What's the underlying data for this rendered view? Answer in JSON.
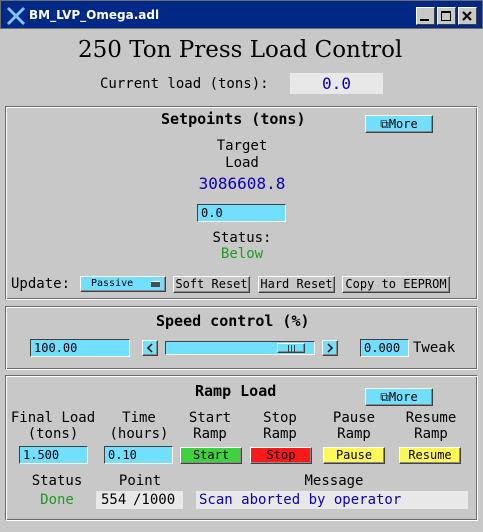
{
  "window": {
    "title": "BM_LVP_Omega.adl"
  },
  "header": {
    "title": "250 Ton Press Load Control",
    "current_load_label": "Current load (tons):",
    "current_load_value": "0.0"
  },
  "setpoints": {
    "heading": "Setpoints (tons)",
    "more_label": "More",
    "target_label_1": "Target",
    "target_label_2": "Load",
    "target_value": "3086608.8",
    "target_input": "0.0",
    "status_label": "Status:",
    "status_value": "Below",
    "update_label": "Update:",
    "update_mode": "Passive",
    "soft_reset": "Soft Reset",
    "hard_reset": "Hard Reset",
    "copy_eeprom": "Copy to EEPROM"
  },
  "speed": {
    "heading": "Speed control (%)",
    "value": "100.00",
    "tweak_value": "0.000",
    "tweak_label": "Tweak",
    "slider_fraction": 0.93
  },
  "ramp": {
    "heading": "Ramp Load",
    "more_label": "More",
    "final_load_label_1": "Final Load",
    "final_load_label_2": "(tons)",
    "time_label_1": "Time",
    "time_label_2": "(hours)",
    "start_label_1": "Start",
    "start_label_2": "Ramp",
    "stop_label_1": "Stop",
    "stop_label_2": "Ramp",
    "pause_label_1": "Pause",
    "pause_label_2": "Ramp",
    "resume_label_1": "Resume",
    "resume_label_2": "Ramp",
    "final_load_value": "1.500",
    "time_value": "0.10",
    "start_btn": "Start",
    "stop_btn": "Stop",
    "pause_btn": "Pause",
    "resume_btn": "Resume",
    "status_header": "Status",
    "point_header": "Point",
    "message_header": "Message",
    "status_value": "Done",
    "point_current": "554",
    "point_total": "/1000",
    "message_value": "Scan aborted by operator"
  },
  "colors": {
    "titlebar": "#002887",
    "entry": "#73dfff",
    "green_text": "#1e9a1e",
    "blue_text": "#0a00b8",
    "start": "#3fd13f",
    "stop": "#fb1a1a",
    "pause": "#fdf75a"
  }
}
